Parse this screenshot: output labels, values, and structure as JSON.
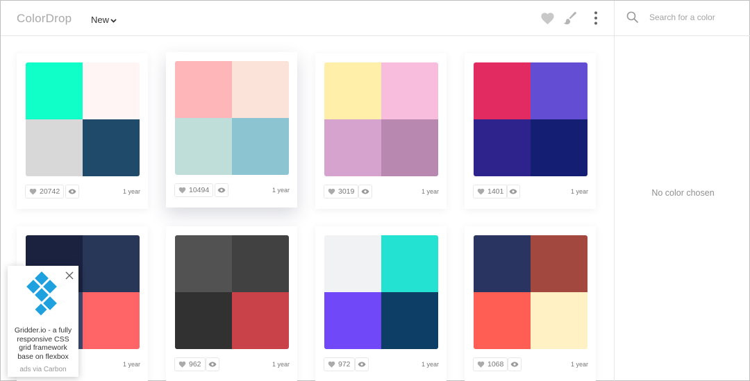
{
  "header": {
    "logo": "ColorDrop",
    "nav_label": "New",
    "icons": [
      "heart-icon",
      "brush-icon",
      "more-vertical-icon"
    ]
  },
  "sidebar": {
    "search_placeholder": "Search for a color",
    "empty_text": "No color chosen"
  },
  "palettes": [
    {
      "colors": [
        "#10ffc8",
        "#fff5f5",
        "#d8d8d8",
        "#1f4a6a"
      ],
      "likes": "20742",
      "age": "1 year"
    },
    {
      "colors": [
        "#ffb6b9",
        "#fbe3da",
        "#bfdeda",
        "#8cc4d2"
      ],
      "likes": "10494",
      "age": "1 year"
    },
    {
      "colors": [
        "#ffefa8",
        "#f8bcdc",
        "#d6a3cf",
        "#b888b1"
      ],
      "likes": "3019",
      "age": "1 year"
    },
    {
      "colors": [
        "#e22b61",
        "#634dd3",
        "#2e238d",
        "#141e73"
      ],
      "likes": "1401",
      "age": "1 year"
    },
    {
      "colors": [
        "#1b2240",
        "#283657",
        "#3b4a72",
        "#ff6567"
      ],
      "likes": "",
      "age": "1 year"
    },
    {
      "colors": [
        "#525252",
        "#414141",
        "#313131",
        "#c9424a"
      ],
      "likes": "962",
      "age": "1 year"
    },
    {
      "colors": [
        "#f0f2f4",
        "#23e2d2",
        "#7048f8",
        "#0d3e66"
      ],
      "likes": "972",
      "age": "1 year"
    },
    {
      "colors": [
        "#2a3460",
        "#a2483f",
        "#ff5e55",
        "#fff1c4"
      ],
      "likes": "1068",
      "age": "1 year"
    }
  ],
  "ad": {
    "text": "Gridder.io - a fully responsive CSS grid framework base on flexbox",
    "via": "ads via Carbon",
    "logo_color": "#1fa1e0"
  },
  "colors": {
    "border": "#e6e6e6",
    "muted_text": "#a9a9a9"
  }
}
